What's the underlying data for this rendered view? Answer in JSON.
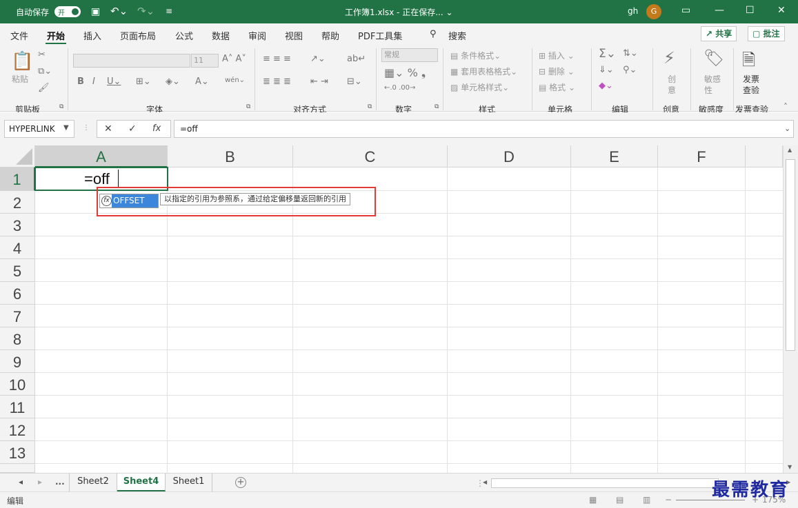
{
  "titlebar": {
    "autosave_label": "自动保存",
    "autosave_state": "开",
    "doc_title": "工作簿1.xlsx - 正在保存... ⌄",
    "user_initials": "gh",
    "avatar_letter": "G"
  },
  "menu": {
    "items": [
      "文件",
      "开始",
      "插入",
      "页面布局",
      "公式",
      "数据",
      "审阅",
      "视图",
      "帮助",
      "PDF工具集"
    ],
    "active_index": 1,
    "search_label": "搜索",
    "share_label": "共享",
    "comment_label": "批注"
  },
  "ribbon": {
    "groups": [
      "剪贴板",
      "字体",
      "对齐方式",
      "数字",
      "样式",
      "单元格",
      "编辑",
      "创意",
      "敏感度",
      "发票查验"
    ],
    "paste_label": "粘贴",
    "font_size": "11",
    "number_format": "常规",
    "cond_format_label": "条件格式",
    "table_format_label": "套用表格格式",
    "cell_style_label": "单元格样式",
    "insert_label": "插入",
    "delete_label": "删除",
    "format_label": "格式",
    "creative_label_1": "创",
    "creative_label_2": "意",
    "sens_label_1": "敏感",
    "sens_label_2": "性",
    "invoice_label_1": "发票",
    "invoice_label_2": "查验"
  },
  "formula_bar": {
    "name_box": "HYPERLINK",
    "formula": "=off"
  },
  "grid": {
    "columns": [
      "A",
      "B",
      "C",
      "D",
      "E",
      "F"
    ],
    "rows": [
      "1",
      "2",
      "3",
      "4",
      "5",
      "6",
      "7",
      "8",
      "9",
      "10",
      "11",
      "12",
      "13"
    ],
    "active_cell_text": "=off",
    "autocomplete": {
      "function_name": "OFFSET",
      "tooltip": "以指定的引用为参照系，通过给定偏移量返回新的引用"
    }
  },
  "sheets": {
    "tabs": [
      "Sheet2",
      "Sheet4",
      "Sheet1"
    ],
    "active_index": 1,
    "more_label": "..."
  },
  "status": {
    "mode": "编辑",
    "zoom": "175%"
  },
  "watermark": "最需教育",
  "colors": {
    "accent": "#217346",
    "highlight": "#3c86db",
    "callout": "#e53935"
  }
}
